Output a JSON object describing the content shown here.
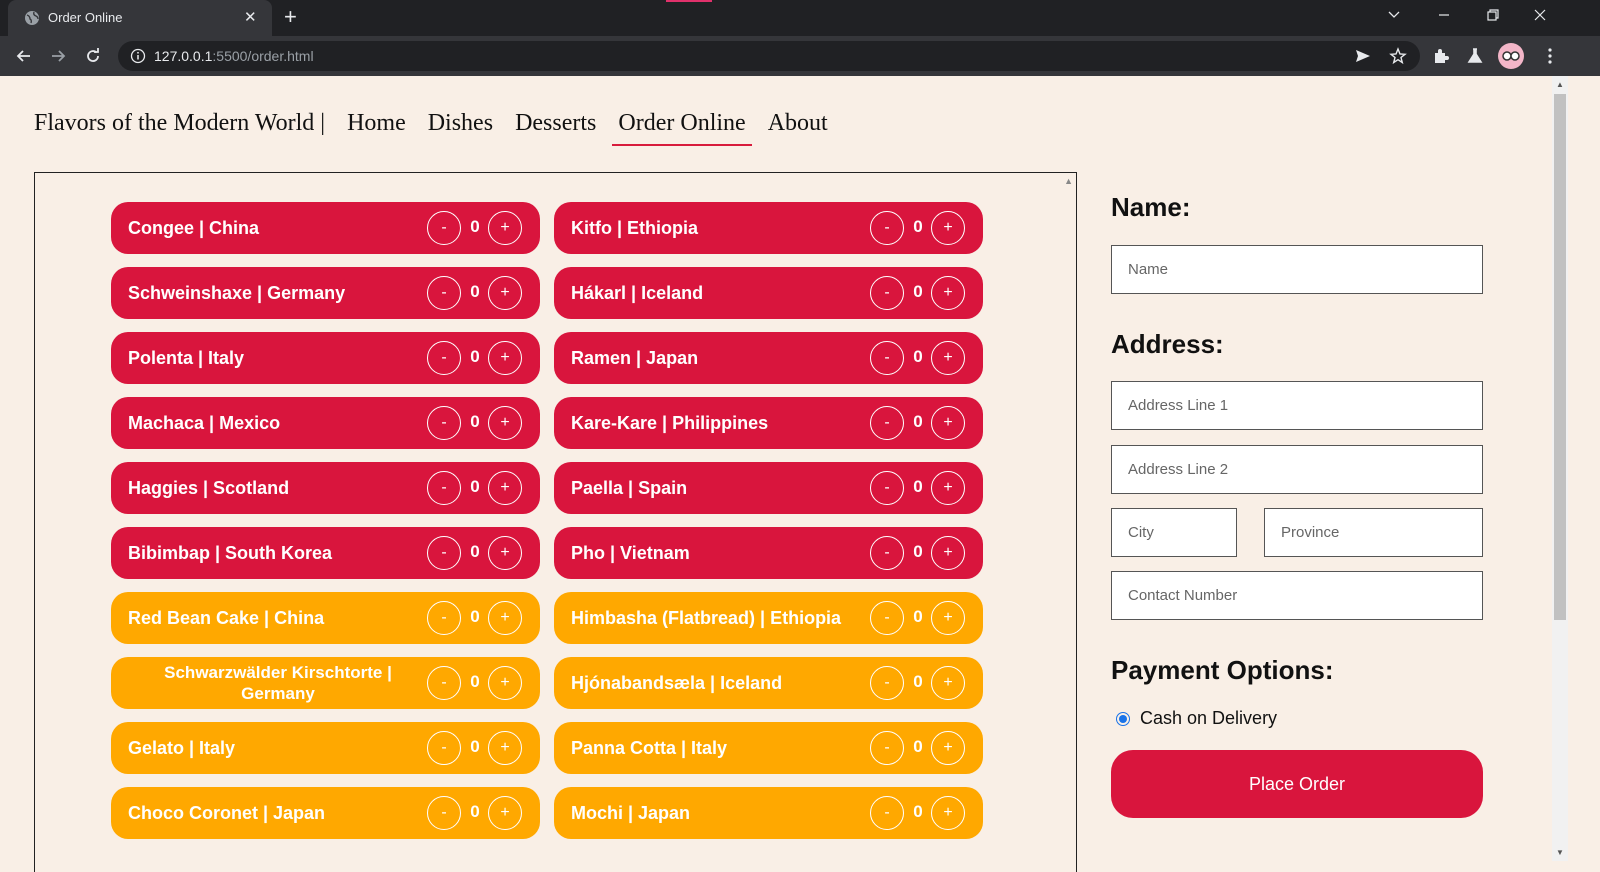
{
  "browser": {
    "tab_title": "Order Online",
    "tab_close": "✕",
    "new_tab": "+",
    "url_host": "127.0.0.1",
    "url_rest": ":5500/order.html"
  },
  "nav": {
    "brand": "Flavors of the Modern World |",
    "links": [
      "Home",
      "Dishes",
      "Desserts",
      "Order Online",
      "About"
    ],
    "active": "Order Online"
  },
  "dishes": [
    {
      "name": "Congee | China",
      "qty": "0",
      "kind": "main"
    },
    {
      "name": "Kitfo | Ethiopia",
      "qty": "0",
      "kind": "main"
    },
    {
      "name": "Schweinshaxe | Germany",
      "qty": "0",
      "kind": "main"
    },
    {
      "name": "Hákarl | Iceland",
      "qty": "0",
      "kind": "main"
    },
    {
      "name": "Polenta | Italy",
      "qty": "0",
      "kind": "main"
    },
    {
      "name": "Ramen | Japan",
      "qty": "0",
      "kind": "main"
    },
    {
      "name": "Machaca | Mexico",
      "qty": "0",
      "kind": "main"
    },
    {
      "name": "Kare-Kare | Philippines",
      "qty": "0",
      "kind": "main"
    },
    {
      "name": "Haggies | Scotland",
      "qty": "0",
      "kind": "main"
    },
    {
      "name": "Paella | Spain",
      "qty": "0",
      "kind": "main"
    },
    {
      "name": "Bibimbap | South Korea",
      "qty": "0",
      "kind": "main"
    },
    {
      "name": "Pho | Vietnam",
      "qty": "0",
      "kind": "main"
    },
    {
      "name": "Red Bean Cake | China",
      "qty": "0",
      "kind": "dessert"
    },
    {
      "name": "Himbasha (Flatbread) | Ethiopia",
      "qty": "0",
      "kind": "dessert"
    },
    {
      "name": "Schwarzwälder Kirschtorte | Germany",
      "qty": "0",
      "kind": "dessert",
      "centered": true
    },
    {
      "name": "Hjónabandsæla | Iceland",
      "qty": "0",
      "kind": "dessert"
    },
    {
      "name": "Gelato | Italy",
      "qty": "0",
      "kind": "dessert"
    },
    {
      "name": "Panna Cotta | Italy",
      "qty": "0",
      "kind": "dessert"
    },
    {
      "name": "Choco Coronet | Japan",
      "qty": "0",
      "kind": "dessert"
    },
    {
      "name": "Mochi | Japan",
      "qty": "0",
      "kind": "dessert"
    }
  ],
  "buttons": {
    "minus": "-",
    "plus": "+"
  },
  "form": {
    "name_heading": "Name:",
    "name_placeholder": "Name",
    "address_heading": "Address:",
    "address1_placeholder": "Address Line 1",
    "address2_placeholder": "Address Line 2",
    "city_placeholder": "City",
    "province_placeholder": "Province",
    "contact_placeholder": "Contact Number",
    "payment_heading": "Payment Options:",
    "payment_option": "Cash on Delivery",
    "submit_label": "Place Order"
  },
  "colors": {
    "main_dish": "#d9153d",
    "dessert": "#ffa800",
    "page_bg": "#f9efe6"
  }
}
